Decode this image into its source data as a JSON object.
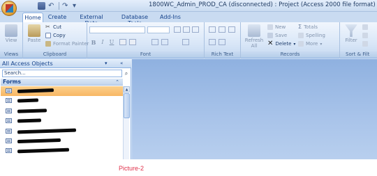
{
  "window": {
    "title": "1800WC_Admin_PROD_CA (disconnected) : Project  (Access 2000 file format) - Microsoft"
  },
  "tabs": [
    {
      "label": "Home",
      "active": true
    },
    {
      "label": "Create",
      "active": false
    },
    {
      "label": "External Data",
      "active": false
    },
    {
      "label": "Database Tools",
      "active": false
    },
    {
      "label": "Add-Ins",
      "active": false
    }
  ],
  "ribbon": {
    "views": {
      "button": "View",
      "label": "Views"
    },
    "clipboard": {
      "paste": "Paste",
      "cut": "Cut",
      "copy": "Copy",
      "format_painter": "Format Painter",
      "label": "Clipboard"
    },
    "font": {
      "bold": "B",
      "italic": "I",
      "underline": "U",
      "label": "Font"
    },
    "rich_text": {
      "label": "Rich Text"
    },
    "records": {
      "refresh": "Refresh",
      "refresh_sub": "All",
      "new": "New",
      "save": "Save",
      "delete": "Delete",
      "totals": "Totals",
      "spelling": "Spelling",
      "more": "More",
      "label": "Records"
    },
    "sort_filter": {
      "filter": "Filter",
      "label": "Sort & Filt"
    }
  },
  "nav_pane": {
    "header": "All Access Objects",
    "search_placeholder": "Search...",
    "section": "Forms",
    "items": [
      {
        "selected": true
      },
      {
        "selected": false
      },
      {
        "selected": false
      },
      {
        "selected": false
      },
      {
        "selected": false
      },
      {
        "selected": false
      },
      {
        "selected": false
      }
    ]
  },
  "caption": "Picture-2",
  "colors": {
    "ribbon_bg": "#dbe8f8",
    "selected_item": "#f8b764",
    "workspace": "#a9c4ea",
    "caption": "#e0314b"
  }
}
